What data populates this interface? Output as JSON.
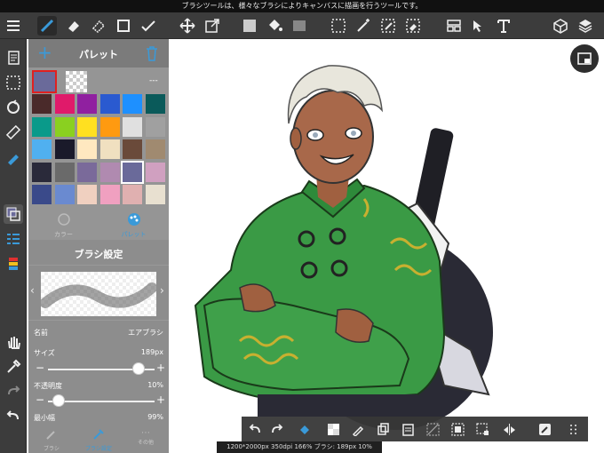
{
  "tooltip": "ブラシツールは、様々なブラシによりキャンバスに描画を行うツールです。",
  "palette": {
    "title": "パレット",
    "add_symbol": "+",
    "current_value": "---",
    "swatches": [
      [
        "#4a2a2a",
        "#e01a6a",
        "#9020a0",
        "#2a5ad0",
        "#1e90ff",
        "#0a5a5a"
      ],
      [
        "#0a9a8a",
        "#8ad020",
        "#ffe020",
        "#ff9a10",
        "#e0e0e0",
        "#a0a0a0"
      ],
      [
        "#50b0f0",
        "#1a1a2a",
        "#ffe8c0",
        "#f0e0c0",
        "#6a4a3a",
        "#a08a70"
      ],
      [
        "#2a2a3a",
        "#6a6a6a",
        "#7a6a9a",
        "#b08ab0",
        "#6a6a9a",
        "#d0a0c0"
      ],
      [
        "#3a4a8a",
        "#6a8ad0",
        "#f0d0c0",
        "#f0a0c0",
        "#e0b0b0",
        "#e8e0d0"
      ]
    ],
    "tabs": [
      {
        "label": "カラー"
      },
      {
        "label": "パレット"
      }
    ]
  },
  "brush": {
    "title": "ブラシ設定",
    "name_label": "名前",
    "name_value": "エアブラシ",
    "size_label": "サイズ",
    "size_value": "189px",
    "size_fraction": 0.85,
    "opacity_label": "不透明度",
    "opacity_value": "10%",
    "opacity_fraction": 0.1,
    "min_label": "最小幅",
    "min_value": "99%",
    "minus": "−",
    "plus": "+",
    "bottom_tabs": [
      {
        "label": "ブラシ"
      },
      {
        "label": "ブラシ設定"
      },
      {
        "label": "その他"
      }
    ]
  },
  "status": "1200*2000px 350dpi 166% ブラシ: 189px 10%",
  "colors": {
    "accent_blue": "#3a9ad9",
    "delete_icon": "#3a9ad9",
    "selected_border": "#e02020"
  }
}
